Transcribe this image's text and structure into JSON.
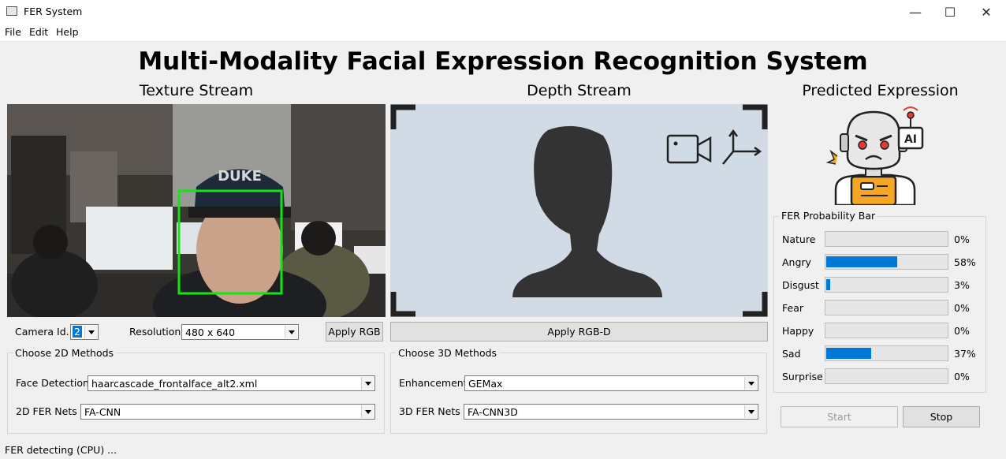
{
  "window": {
    "title": "FER System",
    "minimize": "—",
    "maximize": "☐",
    "close": "✕"
  },
  "menu": [
    "File",
    "Edit",
    "Help"
  ],
  "main_title": "Multi-Modality Facial Expression Recognition System",
  "texture": {
    "title": "Texture Stream",
    "camera_label": "Camera Id.",
    "camera_value": "2",
    "resolution_label": "Resolution",
    "resolution_value": "480 x 640",
    "apply_label": "Apply RGB",
    "box_color": "#14e414"
  },
  "depth": {
    "title": "Depth Stream",
    "apply_label": "Apply RGB-D"
  },
  "methods2d": {
    "title": "Choose 2D Methods",
    "face_label": "Face Detection",
    "face_value": "haarcascade_frontalface_alt2.xml",
    "net_label": "2D FER Nets",
    "net_value": "FA-CNN"
  },
  "methods3d": {
    "title": "Choose 3D Methods",
    "enh_label": "Enhancement",
    "enh_value": "GEMax",
    "net_label": "3D FER Nets",
    "net_value": "FA-CNN3D"
  },
  "prediction": {
    "title": "Predicted Expression",
    "icon": "angry-robot-icon",
    "bar_title": "FER Probability Bar",
    "bars": [
      {
        "label": "Nature",
        "value": 0,
        "pct": "0%"
      },
      {
        "label": "Angry",
        "value": 58,
        "pct": "58%"
      },
      {
        "label": "Disgust",
        "value": 3,
        "pct": "3%"
      },
      {
        "label": "Fear",
        "value": 0,
        "pct": "0%"
      },
      {
        "label": "Happy",
        "value": 0,
        "pct": "0%"
      },
      {
        "label": "Sad",
        "value": 37,
        "pct": "37%"
      },
      {
        "label": "Surprise",
        "value": 0,
        "pct": "0%"
      }
    ],
    "start_label": "Start",
    "stop_label": "Stop"
  },
  "status": "FER detecting (CPU) ...",
  "colors": {
    "accent": "#0078d7",
    "depth_bg": "#d0dbe5",
    "robot_orange": "#f5a623",
    "robot_red": "#e53935"
  }
}
